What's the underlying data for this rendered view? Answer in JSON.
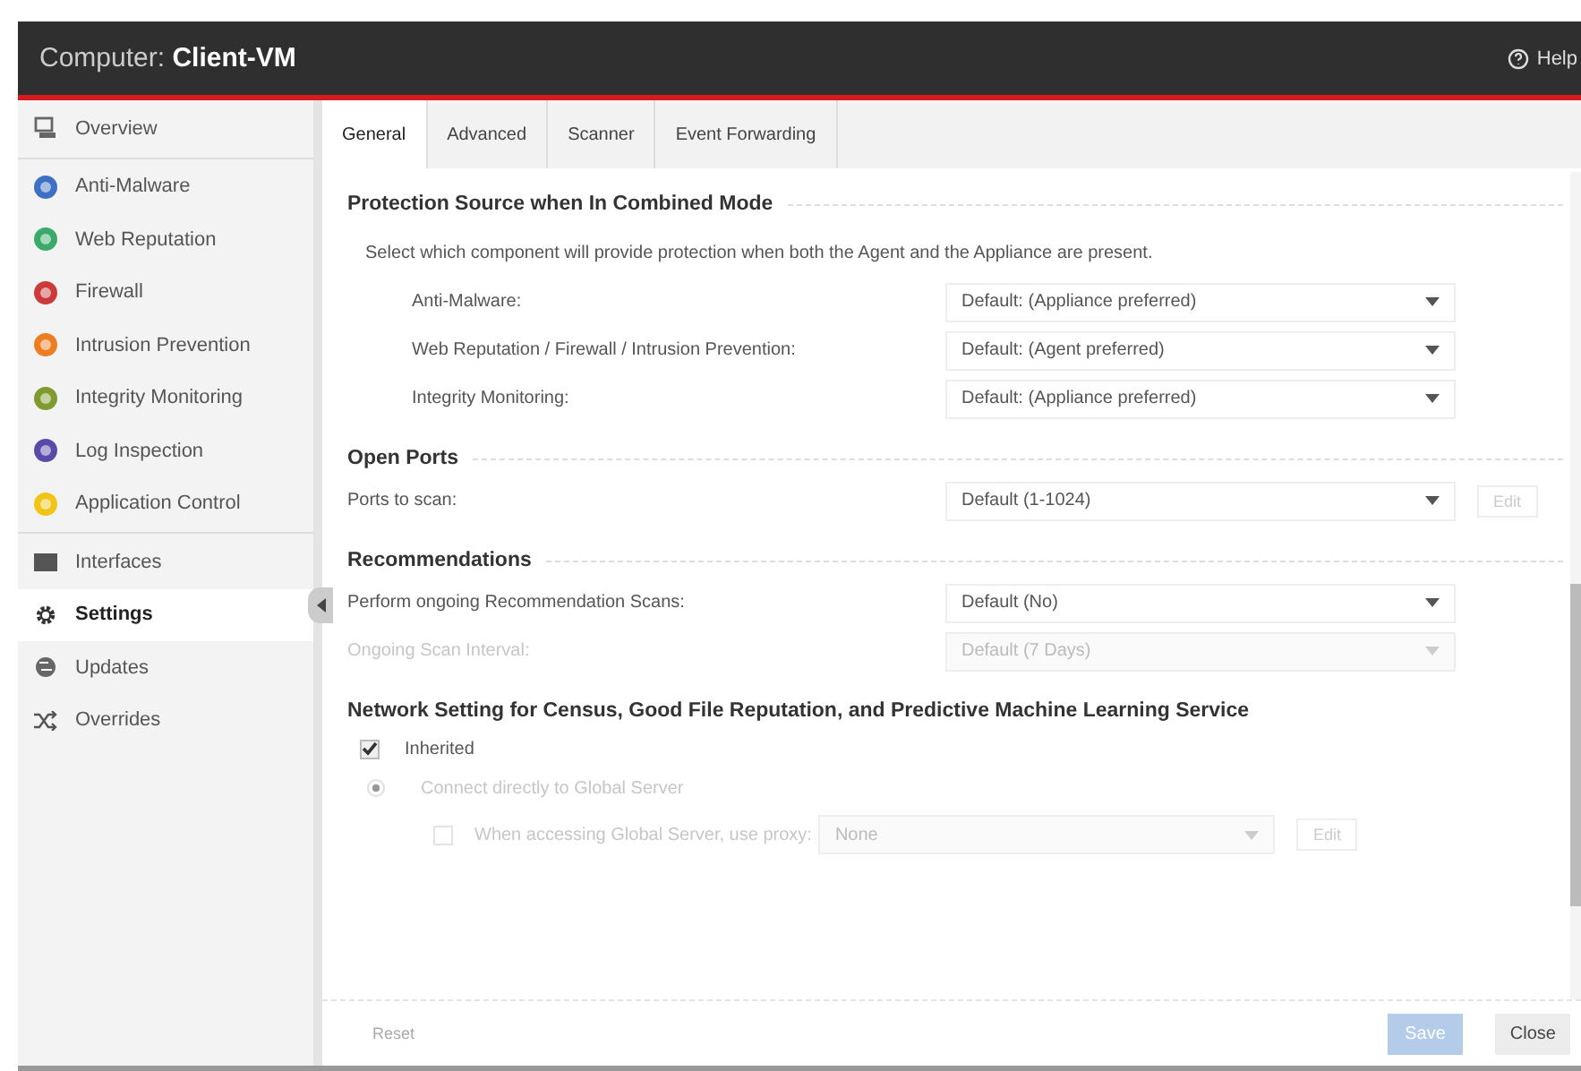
{
  "header": {
    "title_label": "Computer:",
    "title_name": "Client-VM",
    "help": "Help"
  },
  "sidebar": {
    "groups": [
      [
        {
          "label": "Overview",
          "kind": "monitor",
          "selected": false
        }
      ],
      [
        {
          "label": "Anti-Malware",
          "kind": "dot",
          "color": "#3d6fc4",
          "selected": false
        },
        {
          "label": "Web Reputation",
          "kind": "dot",
          "color": "#3aaa6a",
          "selected": false
        },
        {
          "label": "Firewall",
          "kind": "dot",
          "color": "#cc3b3b",
          "selected": false
        },
        {
          "label": "Intrusion Prevention",
          "kind": "dot",
          "color": "#ee7d22",
          "selected": false
        },
        {
          "label": "Integrity Monitoring",
          "kind": "dot",
          "color": "#7f9a2e",
          "selected": false
        },
        {
          "label": "Log Inspection",
          "kind": "dot",
          "color": "#5a4aa8",
          "selected": false
        },
        {
          "label": "Application Control",
          "kind": "dot",
          "color": "#f2c418",
          "selected": false
        }
      ],
      [
        {
          "label": "Interfaces",
          "kind": "card",
          "selected": false
        },
        {
          "label": "Settings",
          "kind": "gear",
          "selected": true
        },
        {
          "label": "Updates",
          "kind": "globe",
          "selected": false
        },
        {
          "label": "Overrides",
          "kind": "shuffle",
          "selected": false
        }
      ]
    ]
  },
  "tabs": [
    {
      "label": "General",
      "selected": true
    },
    {
      "label": "Advanced",
      "selected": false
    },
    {
      "label": "Scanner",
      "selected": false
    },
    {
      "label": "Event Forwarding",
      "selected": false
    }
  ],
  "protection": {
    "heading": "Protection Source when In Combined Mode",
    "description": "Select which component will provide protection when both the Agent and the Appliance are present.",
    "rows": [
      {
        "label": "Anti-Malware:",
        "value": "Default: (Appliance preferred)",
        "disabled": false
      },
      {
        "label": "Web Reputation / Firewall / Intrusion Prevention:",
        "value": "Default: (Agent preferred)",
        "disabled": false
      },
      {
        "label": "Integrity Monitoring:",
        "value": "Default: (Appliance preferred)",
        "disabled": false
      }
    ]
  },
  "open_ports": {
    "heading": "Open Ports",
    "rows": [
      {
        "label": "Ports to scan:",
        "value": "Default (1-1024)",
        "disabled": false,
        "edit": "Edit"
      }
    ]
  },
  "recommendations": {
    "heading": "Recommendations",
    "rows": [
      {
        "label": "Perform ongoing Recommendation Scans:",
        "value": "Default (No)",
        "disabled": false
      },
      {
        "label": "Ongoing Scan Interval:",
        "value": "Default (7 Days)",
        "disabled": true
      }
    ]
  },
  "network": {
    "heading": "Network Setting for Census, Good File Reputation, and Predictive Machine Learning Service",
    "inherited": {
      "label": "Inherited",
      "checked": true
    },
    "direct": {
      "label": "Connect directly to Global Server",
      "selected": true,
      "disabled": true
    },
    "proxy": {
      "label": "When accessing Global Server, use proxy:",
      "checked": false,
      "disabled": true,
      "value": "None",
      "edit": "Edit"
    }
  },
  "footer": {
    "reset": "Reset",
    "save": "Save",
    "close": "Close"
  }
}
